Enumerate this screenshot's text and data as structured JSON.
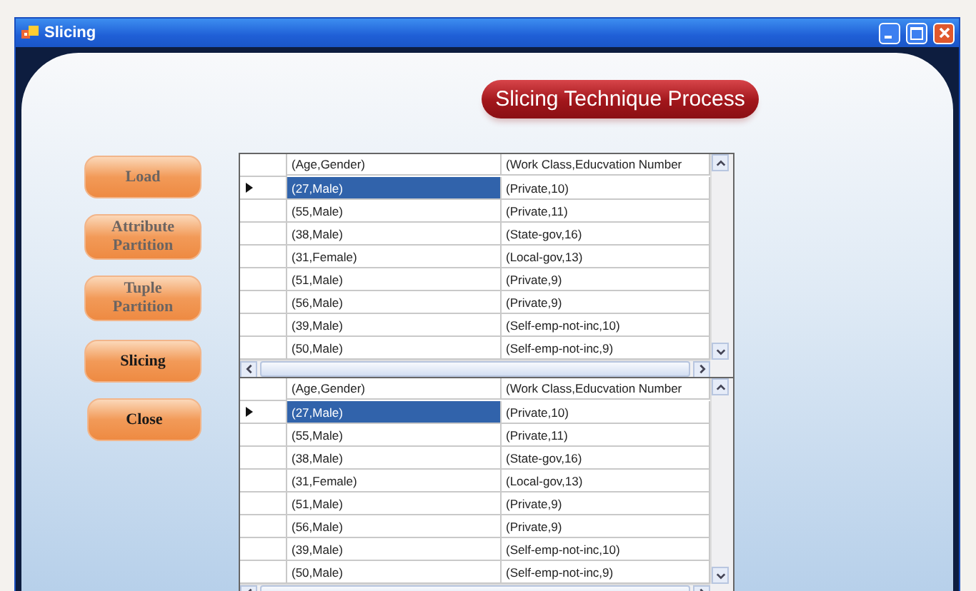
{
  "window": {
    "title": "Slicing"
  },
  "banner": "Slicing Technique Process",
  "buttons": [
    {
      "label": "Load",
      "disabled": true
    },
    {
      "label": "Attribute Partition",
      "disabled": true
    },
    {
      "label": "Tuple Partition",
      "disabled": true
    },
    {
      "label": "Slicing",
      "disabled": false
    },
    {
      "label": "Close",
      "disabled": false
    }
  ],
  "grids": [
    {
      "columns": [
        "(Age,Gender)",
        "(Work Class,Educvation Number"
      ],
      "rows": [
        {
          "cells": [
            "(27,Male)",
            "(Private,10)"
          ],
          "selected": true
        },
        {
          "cells": [
            "(55,Male)",
            "(Private,11)"
          ],
          "selected": false
        },
        {
          "cells": [
            "(38,Male)",
            "(State-gov,16)"
          ],
          "selected": false
        },
        {
          "cells": [
            "(31,Female)",
            "(Local-gov,13)"
          ],
          "selected": false
        },
        {
          "cells": [
            "(51,Male)",
            "(Private,9)"
          ],
          "selected": false
        },
        {
          "cells": [
            "(56,Male)",
            "(Private,9)"
          ],
          "selected": false
        },
        {
          "cells": [
            "(39,Male)",
            "(Self-emp-not-inc,10)"
          ],
          "selected": false
        },
        {
          "cells": [
            "(50,Male)",
            "(Self-emp-not-inc,9)"
          ],
          "selected": false
        }
      ]
    },
    {
      "columns": [
        "(Age,Gender)",
        "(Work Class,Educvation Number"
      ],
      "rows": [
        {
          "cells": [
            "(27,Male)",
            "(Private,10)"
          ],
          "selected": true
        },
        {
          "cells": [
            "(55,Male)",
            "(Private,11)"
          ],
          "selected": false
        },
        {
          "cells": [
            "(38,Male)",
            "(State-gov,16)"
          ],
          "selected": false
        },
        {
          "cells": [
            "(31,Female)",
            "(Local-gov,13)"
          ],
          "selected": false
        },
        {
          "cells": [
            "(51,Male)",
            "(Private,9)"
          ],
          "selected": false
        },
        {
          "cells": [
            "(56,Male)",
            "(Private,9)"
          ],
          "selected": false
        },
        {
          "cells": [
            "(39,Male)",
            "(Self-emp-not-inc,10)"
          ],
          "selected": false
        },
        {
          "cells": [
            "(50,Male)",
            "(Self-emp-not-inc,9)"
          ],
          "selected": false
        }
      ]
    }
  ]
}
